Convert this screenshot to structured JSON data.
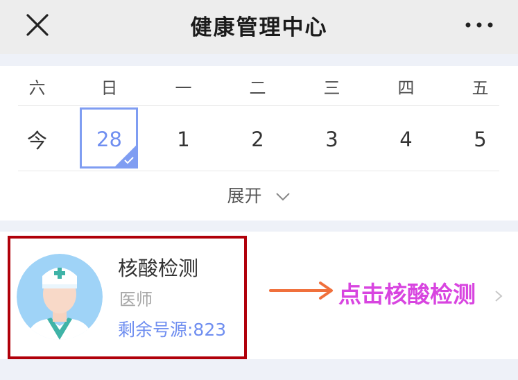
{
  "header": {
    "title": "健康管理中心",
    "close_icon": "close-icon",
    "more_icon": "more-icon"
  },
  "calendar": {
    "weekdays": [
      "六",
      "日",
      "一",
      "二",
      "三",
      "四",
      "五"
    ],
    "dates": [
      "今",
      "28",
      "1",
      "2",
      "3",
      "4",
      "5"
    ],
    "selected_date": "28",
    "expand_label": "展开",
    "accent": "#7f9df2"
  },
  "service": {
    "name": "核酸检测",
    "role": "医师",
    "quota": "剩余号源:823",
    "highlight_color": "#b0000a"
  },
  "annotation": {
    "text": "点击核酸检测",
    "text_color": "#d845e0",
    "arrow_color": "#f0703c"
  }
}
